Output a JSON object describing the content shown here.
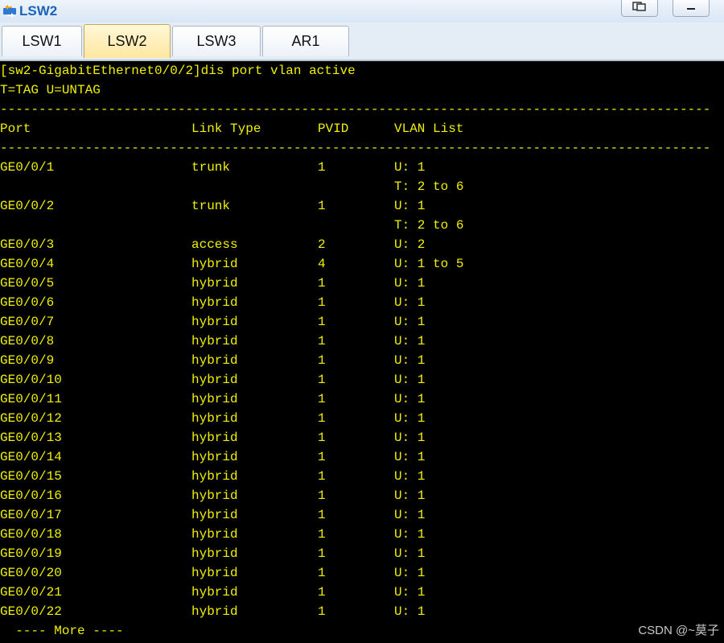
{
  "window": {
    "title": "LSW2"
  },
  "tabs": [
    {
      "label": "LSW1",
      "active": false
    },
    {
      "label": "LSW2",
      "active": true
    },
    {
      "label": "LSW3",
      "active": false
    },
    {
      "label": "AR1",
      "active": false
    }
  ],
  "terminal": {
    "command_line": "[sw2-GigabitEthernet0/0/2]dis port vlan active",
    "legend": "T=TAG U=UNTAG",
    "separator": "--------------------------------------------------------------------------------------------",
    "headers": {
      "port": "Port",
      "link_type": "Link Type",
      "pvid": "PVID",
      "vlan_list": "VLAN List"
    },
    "rows": [
      {
        "port": "GE0/0/1",
        "link_type": "trunk",
        "pvid": "1",
        "vlan": "U: 1"
      },
      {
        "port": "",
        "link_type": "",
        "pvid": "",
        "vlan": "T: 2 to 6"
      },
      {
        "port": "GE0/0/2",
        "link_type": "trunk",
        "pvid": "1",
        "vlan": "U: 1"
      },
      {
        "port": "",
        "link_type": "",
        "pvid": "",
        "vlan": "T: 2 to 6"
      },
      {
        "port": "GE0/0/3",
        "link_type": "access",
        "pvid": "2",
        "vlan": "U: 2"
      },
      {
        "port": "GE0/0/4",
        "link_type": "hybrid",
        "pvid": "4",
        "vlan": "U: 1 to 5"
      },
      {
        "port": "GE0/0/5",
        "link_type": "hybrid",
        "pvid": "1",
        "vlan": "U: 1"
      },
      {
        "port": "GE0/0/6",
        "link_type": "hybrid",
        "pvid": "1",
        "vlan": "U: 1"
      },
      {
        "port": "GE0/0/7",
        "link_type": "hybrid",
        "pvid": "1",
        "vlan": "U: 1"
      },
      {
        "port": "GE0/0/8",
        "link_type": "hybrid",
        "pvid": "1",
        "vlan": "U: 1"
      },
      {
        "port": "GE0/0/9",
        "link_type": "hybrid",
        "pvid": "1",
        "vlan": "U: 1"
      },
      {
        "port": "GE0/0/10",
        "link_type": "hybrid",
        "pvid": "1",
        "vlan": "U: 1"
      },
      {
        "port": "GE0/0/11",
        "link_type": "hybrid",
        "pvid": "1",
        "vlan": "U: 1"
      },
      {
        "port": "GE0/0/12",
        "link_type": "hybrid",
        "pvid": "1",
        "vlan": "U: 1"
      },
      {
        "port": "GE0/0/13",
        "link_type": "hybrid",
        "pvid": "1",
        "vlan": "U: 1"
      },
      {
        "port": "GE0/0/14",
        "link_type": "hybrid",
        "pvid": "1",
        "vlan": "U: 1"
      },
      {
        "port": "GE0/0/15",
        "link_type": "hybrid",
        "pvid": "1",
        "vlan": "U: 1"
      },
      {
        "port": "GE0/0/16",
        "link_type": "hybrid",
        "pvid": "1",
        "vlan": "U: 1"
      },
      {
        "port": "GE0/0/17",
        "link_type": "hybrid",
        "pvid": "1",
        "vlan": "U: 1"
      },
      {
        "port": "GE0/0/18",
        "link_type": "hybrid",
        "pvid": "1",
        "vlan": "U: 1"
      },
      {
        "port": "GE0/0/19",
        "link_type": "hybrid",
        "pvid": "1",
        "vlan": "U: 1"
      },
      {
        "port": "GE0/0/20",
        "link_type": "hybrid",
        "pvid": "1",
        "vlan": "U: 1"
      },
      {
        "port": "GE0/0/21",
        "link_type": "hybrid",
        "pvid": "1",
        "vlan": "U: 1"
      },
      {
        "port": "GE0/0/22",
        "link_type": "hybrid",
        "pvid": "1",
        "vlan": "U: 1"
      }
    ],
    "more_prompt": "  ---- More ----"
  },
  "watermark": "CSDN @~莫子",
  "colors": {
    "terminal_bg": "#000000",
    "terminal_text": "#f0f000",
    "title_text": "#1a63b8",
    "active_tab": "#ffe7a0"
  },
  "icons": {
    "title_icon": "switch-icon",
    "restore": "restore-icon",
    "minimize": "minimize-icon"
  }
}
